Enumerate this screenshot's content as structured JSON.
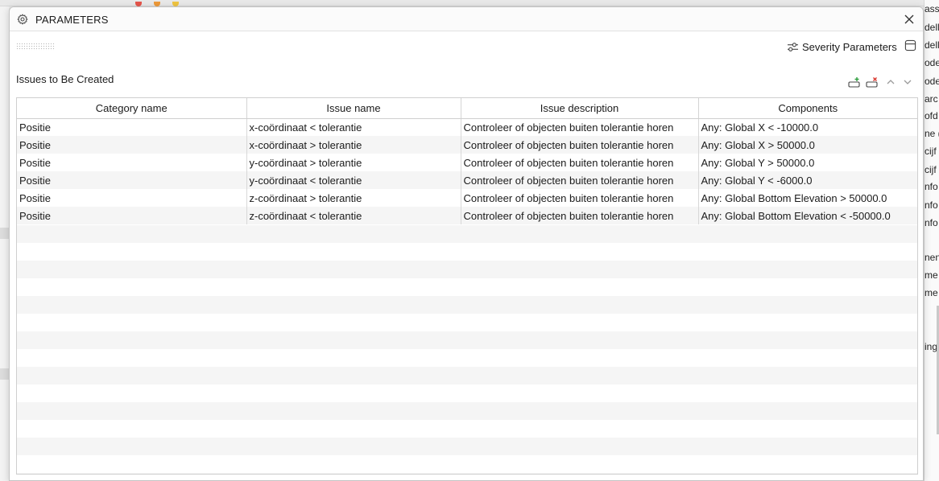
{
  "window": {
    "title": "PARAMETERS",
    "title_icon": "gear-icon",
    "close_icon": "close-icon"
  },
  "toolbar": {
    "severity_label": "Severity Parameters",
    "severity_icon": "sliders-icon",
    "panel_icon": "panel-icon"
  },
  "section": {
    "title": "Issues to Be Created",
    "buttons": [
      "add-row-icon",
      "remove-row-icon",
      "chevron-up-icon",
      "chevron-down-icon"
    ]
  },
  "table": {
    "columns": [
      "Category name",
      "Issue name",
      "Issue description",
      "Components"
    ],
    "rows": [
      [
        "Positie",
        "x-coördinaat < tolerantie",
        "Controleer of objecten buiten tolerantie horen",
        "Any: Global X < -10000.0"
      ],
      [
        "Positie",
        "x-coördinaat > tolerantie",
        "Controleer of objecten buiten tolerantie horen",
        "Any: Global X > 50000.0"
      ],
      [
        "Positie",
        "y-coördinaat > tolerantie",
        "Controleer of objecten buiten tolerantie horen",
        "Any: Global Y > 50000.0"
      ],
      [
        "Positie",
        "y-coördinaat < tolerantie",
        "Controleer of objecten buiten tolerantie horen",
        "Any: Global Y < -6000.0"
      ],
      [
        "Positie",
        "z-coördinaat > tolerantie",
        "Controleer of objecten buiten tolerantie horen",
        "Any: Global Bottom Elevation > 50000.0"
      ],
      [
        "Positie",
        "z-coördinaat < tolerantie",
        "Controleer of objecten buiten tolerantie horen",
        "Any: Global Bottom Elevation < -50000.0"
      ]
    ]
  },
  "background": {
    "right_fragments": [
      "assi",
      "dell",
      "dell",
      "odel",
      "odel",
      "arc",
      "ofd",
      "ne (",
      "cijf",
      "cijf",
      "nfo",
      "nfo",
      "nfo",
      "nen",
      "me",
      "me",
      "ing"
    ]
  },
  "colors": {
    "add_accent": "#2e9e3e",
    "remove_accent": "#d9352c"
  }
}
